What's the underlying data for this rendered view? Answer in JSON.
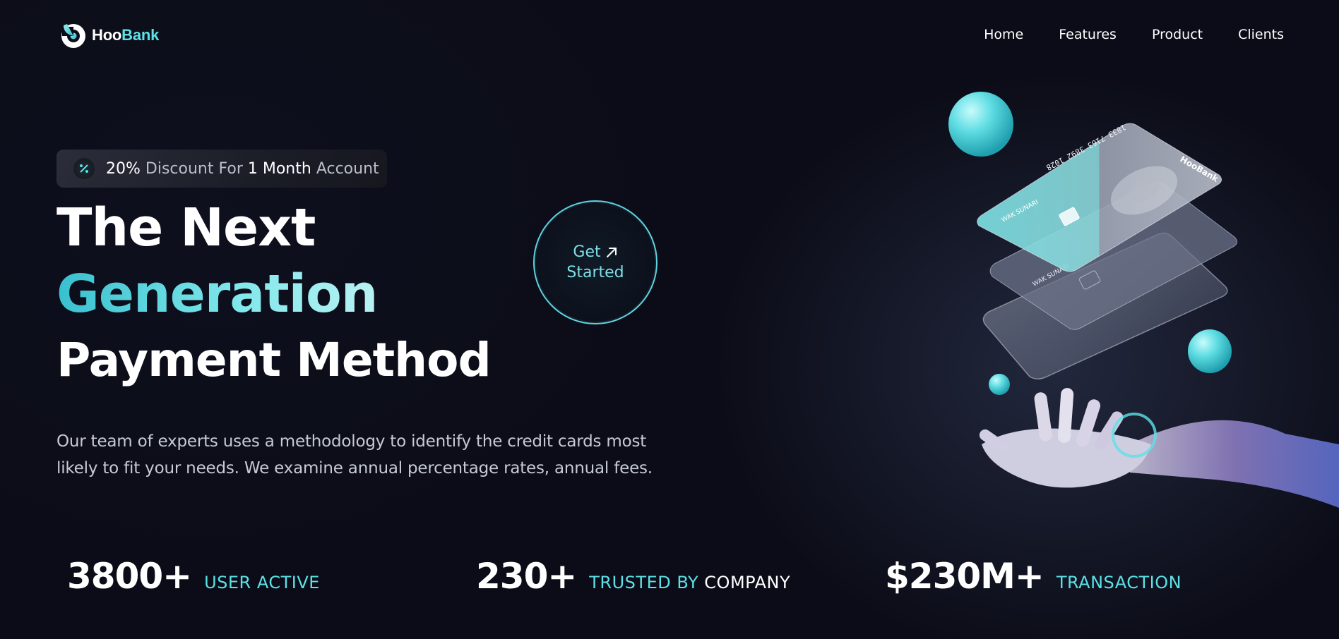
{
  "brand": {
    "name_part1": "Hoo",
    "name_part2": "Bank",
    "accent": "#5ce1e6"
  },
  "nav": {
    "items": [
      "Home",
      "Features",
      "Product",
      "Clients"
    ]
  },
  "promo": {
    "icon": "discount-icon",
    "pct": "20%",
    "text1": "Discount For",
    "num": "1 Month",
    "text2": "Account"
  },
  "headline": {
    "line1": "The Next",
    "line2": "Generation",
    "line3": "Payment Method"
  },
  "paragraph": "Our team of experts uses a methodology to identify the credit cards most likely to fit your needs. We examine annual percentage rates, annual fees.",
  "cta": {
    "line1": "Get",
    "line2": "Started",
    "icon": "arrow-up-right-icon"
  },
  "stats": [
    {
      "value": "3800+",
      "label": "USER ACTIVE"
    },
    {
      "value": "230+",
      "label_a": "TRUSTED BY",
      "label_b": "COMPANY"
    },
    {
      "value": "$230M+",
      "label": "TRANSACTION"
    }
  ],
  "card": {
    "number": "1833 7163 3892 1028",
    "holder": "WAK SUNARI",
    "brand": "HooBank"
  }
}
